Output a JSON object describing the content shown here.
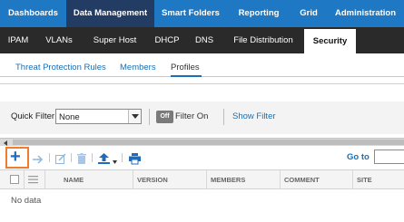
{
  "top_nav": {
    "tabs": [
      {
        "label": "Dashboards"
      },
      {
        "label": "Data Management"
      },
      {
        "label": "Smart Folders"
      },
      {
        "label": "Reporting"
      },
      {
        "label": "Grid"
      },
      {
        "label": "Administration"
      }
    ],
    "active": "Data Management"
  },
  "sub_nav": {
    "tabs": [
      {
        "label": "IPAM"
      },
      {
        "label": "VLANs"
      },
      {
        "label": "Super Host"
      },
      {
        "label": "DHCP"
      },
      {
        "label": "DNS"
      },
      {
        "label": "File Distribution"
      },
      {
        "label": "Security"
      }
    ],
    "active": "Security"
  },
  "section_tabs": {
    "tabs": [
      {
        "label": "Threat Protection Rules"
      },
      {
        "label": "Members"
      },
      {
        "label": "Profiles"
      }
    ],
    "active": "Profiles"
  },
  "filter_bar": {
    "quick_filter_label": "Quick Filter",
    "quick_filter_value": "None",
    "toggle_label": "Off",
    "filter_state_label": "Filter On",
    "show_filter_label": "Show Filter"
  },
  "toolbar": {
    "add_icon": "plus-icon",
    "goto_label": "Go to",
    "goto_value": ""
  },
  "grid": {
    "columns": [
      "NAME",
      "VERSION",
      "MEMBERS",
      "COMMENT",
      "SITE"
    ],
    "empty_text": "No data"
  },
  "colors": {
    "top_nav_bg": "#1f78c3",
    "top_nav_active": "#233c64",
    "sub_nav_bg": "#2a2a2a",
    "link": "#1a6fb5",
    "highlight": "#ee7d31"
  }
}
